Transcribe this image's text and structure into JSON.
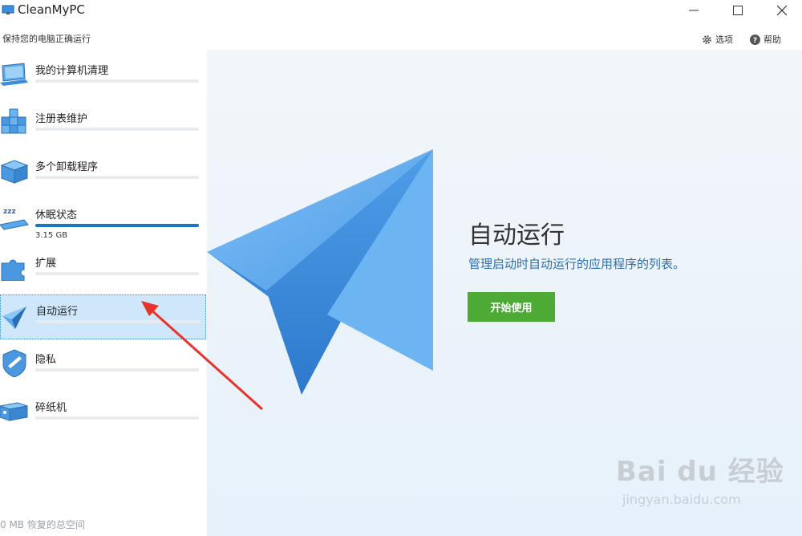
{
  "window": {
    "title": "CleanMyPC"
  },
  "header": {
    "subtitle": "保持您的电脑正确运行",
    "options_label": "选项",
    "help_label": "帮助"
  },
  "sidebar": {
    "items": [
      {
        "label": "我的计算机清理",
        "progress": 0
      },
      {
        "label": "注册表维护",
        "progress": 0
      },
      {
        "label": "多个卸载程序",
        "progress": 0
      },
      {
        "label": "休眠状态",
        "progress": 1.0,
        "sub": "3.15 GB"
      },
      {
        "label": "扩展",
        "progress": 0
      },
      {
        "label": "自动运行",
        "progress": 0,
        "active": true
      },
      {
        "label": "隐私",
        "progress": 0
      },
      {
        "label": "碎纸机",
        "progress": 0
      }
    ],
    "footer": "0 MB 恢复的总空间"
  },
  "main": {
    "title": "自动运行",
    "description": "管理启动时自动运行的应用程序的列表。",
    "start_button": "开始使用"
  },
  "watermark": {
    "main": "Bai du 经验",
    "sub": "jingyan.baidu.com"
  },
  "colors": {
    "accent_green": "#4caa35",
    "progress_blue": "#1d74c5",
    "active_bg": "#cfe7fb",
    "annotation_red": "#e8322b"
  }
}
